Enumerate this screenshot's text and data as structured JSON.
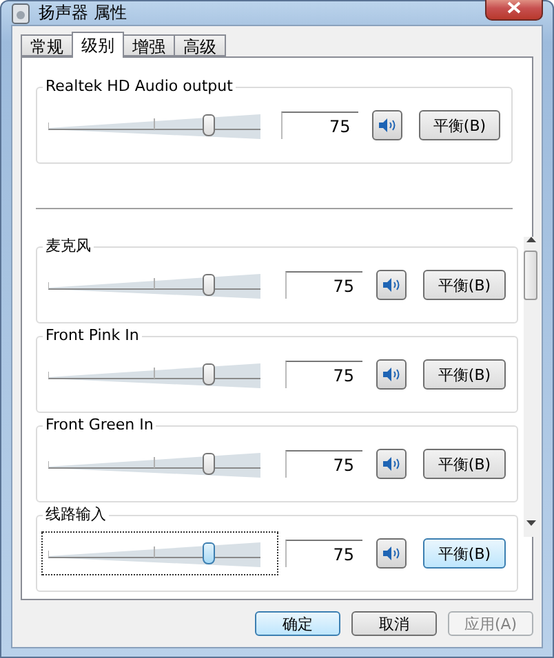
{
  "window": {
    "title": "扬声器 属性"
  },
  "tabs": [
    {
      "label": "常规",
      "selected": false
    },
    {
      "label": "级别",
      "selected": true
    },
    {
      "label": "增强",
      "selected": false
    },
    {
      "label": "高级",
      "selected": false
    }
  ],
  "output": {
    "name": "Realtek HD Audio output",
    "level": 0.75,
    "value": "75",
    "muted": false,
    "focused": false,
    "balance": "平衡(B)"
  },
  "inputs": [
    {
      "name": "麦克风",
      "level": 0.75,
      "value": "75",
      "muted": false,
      "focused": false,
      "balance": "平衡(B)"
    },
    {
      "name": "Front Pink In",
      "level": 0.75,
      "value": "75",
      "muted": false,
      "focused": false,
      "balance": "平衡(B)"
    },
    {
      "name": "Front Green In",
      "level": 0.75,
      "value": "75",
      "muted": false,
      "focused": false,
      "balance": "平衡(B)"
    },
    {
      "name": "线路输入",
      "level": 0.75,
      "value": "75",
      "muted": false,
      "focused": true,
      "balance": "平衡(B)"
    }
  ],
  "buttons": [
    {
      "label": "确定",
      "default": true,
      "disabled": false
    },
    {
      "label": "取消",
      "default": false,
      "disabled": false
    },
    {
      "label": "应用(A)",
      "default": false,
      "disabled": true
    }
  ]
}
